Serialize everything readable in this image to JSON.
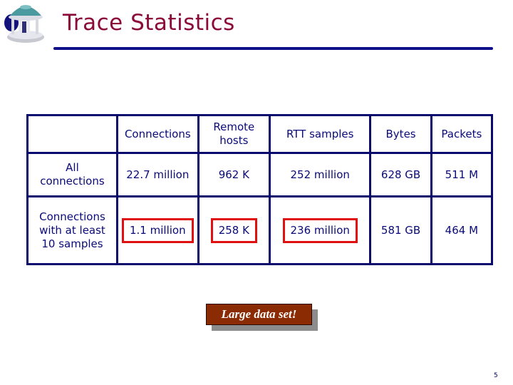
{
  "slide": {
    "title": "Trace Statistics",
    "page_number": "5",
    "logo_icon": "old-well-icon"
  },
  "table": {
    "columns": [
      "",
      "Connections",
      "Remote\nhosts",
      "RTT samples",
      "Bytes",
      "Packets"
    ],
    "rows": [
      {
        "label": "All\nconnections",
        "cells": [
          "22.7 million",
          "962 K",
          "252 million",
          "628 GB",
          "511 M"
        ],
        "highlighted": [
          false,
          false,
          false,
          false,
          false
        ]
      },
      {
        "label": "Connections\nwith at least\n10 samples",
        "cells": [
          "1.1 million",
          "258 K",
          "236 million",
          "581 GB",
          "464 M"
        ],
        "highlighted": [
          true,
          true,
          true,
          false,
          false
        ]
      }
    ]
  },
  "callout": {
    "text": "Large data set!"
  },
  "colors": {
    "title": "#8b0a3a",
    "table_text": "#0a0a78",
    "highlight": "#e01010",
    "callout_bg": "#8b2b04"
  }
}
